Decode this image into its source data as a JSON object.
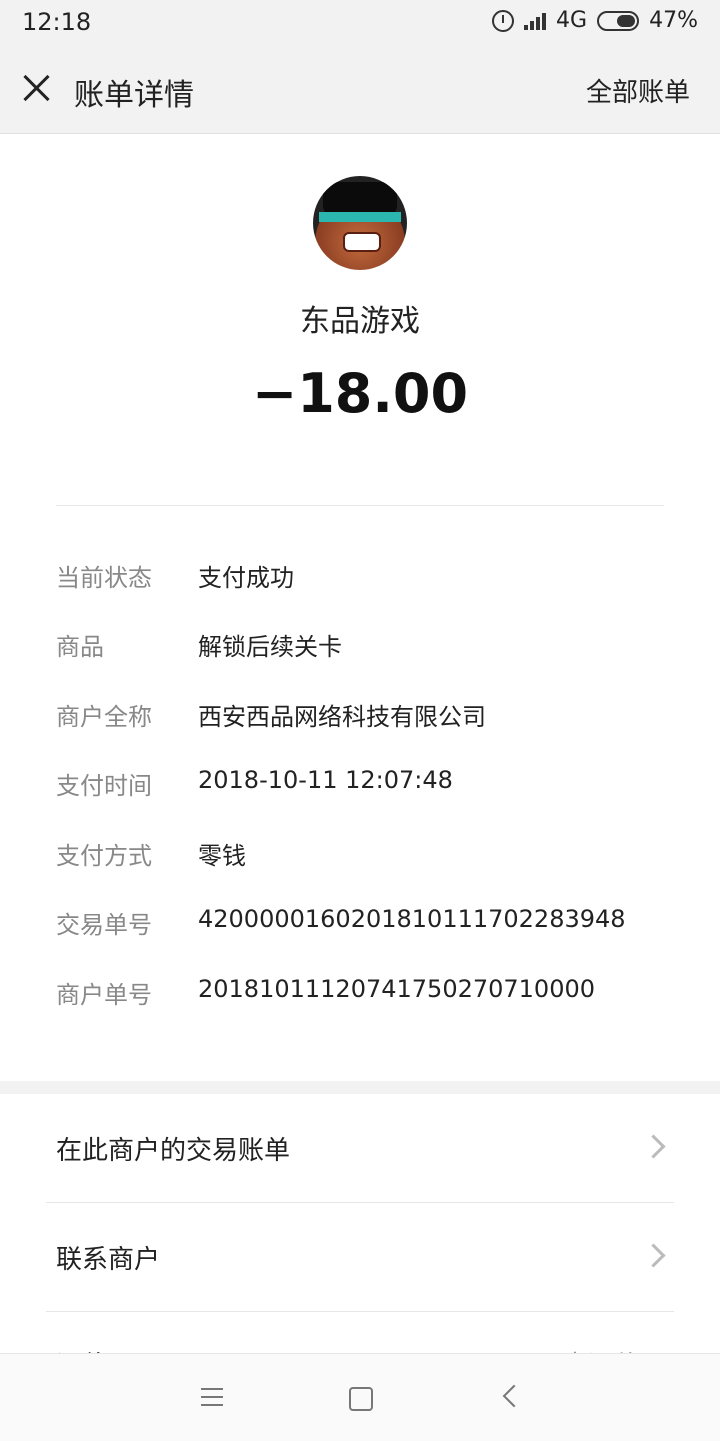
{
  "status_bar": {
    "time": "12:18",
    "network": "4G",
    "battery": "47%"
  },
  "header": {
    "title": "账单详情",
    "all_bills_label": "全部账单"
  },
  "merchant": {
    "name": "东品游戏",
    "amount": "−18.00"
  },
  "details": [
    {
      "label": "当前状态",
      "value": "支付成功"
    },
    {
      "label": "商品",
      "value": "解锁后续关卡"
    },
    {
      "label": "商户全称",
      "value": "西安西品网络科技有限公司"
    },
    {
      "label": "支付时间",
      "value": "2018-10-11 12:07:48"
    },
    {
      "label": "支付方式",
      "value": "零钱"
    },
    {
      "label": "交易单号",
      "value": "4200000160201810111702283948"
    },
    {
      "label": "商户单号",
      "value": "20181011120741750270710000"
    }
  ],
  "actions": [
    {
      "label": "在此商户的交易账单"
    },
    {
      "label": "联系商户"
    }
  ],
  "partial_row": {
    "label": "评价",
    "value": "去评价"
  }
}
